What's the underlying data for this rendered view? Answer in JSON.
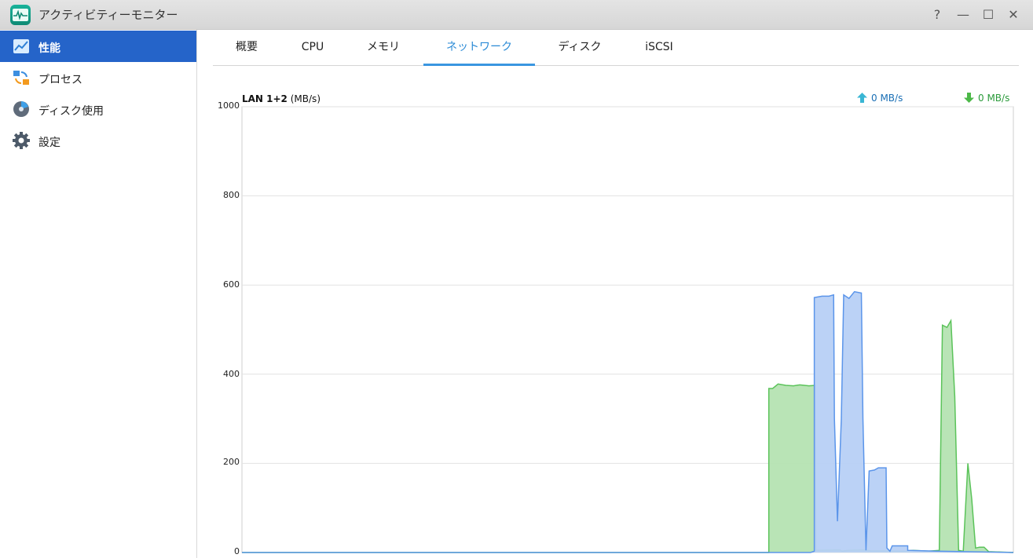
{
  "window": {
    "title": "アクティビティーモニター",
    "help": "?",
    "minimize": "—",
    "maximize": "☐",
    "close": "✕"
  },
  "sidebar": {
    "items": [
      {
        "label": "性能",
        "icon": "performance-chart-icon",
        "active": true
      },
      {
        "label": "プロセス",
        "icon": "process-icon",
        "active": false
      },
      {
        "label": "ディスク使用",
        "icon": "disk-usage-icon",
        "active": false
      },
      {
        "label": "設定",
        "icon": "gear-icon",
        "active": false
      }
    ]
  },
  "tabs": [
    {
      "label": "概要",
      "active": false
    },
    {
      "label": "CPU",
      "active": false
    },
    {
      "label": "メモリ",
      "active": false
    },
    {
      "label": "ネットワーク",
      "active": true
    },
    {
      "label": "ディスク",
      "active": false
    },
    {
      "label": "iSCSI",
      "active": false
    }
  ],
  "network": {
    "interface_bold": "LAN 1+2",
    "unit": "(MB/s)",
    "upload_rate": "0 MB/s",
    "download_rate": "0 MB/s"
  },
  "colors": {
    "accent": "#2564c9",
    "tab_active": "#2a8ad6",
    "upload_fill": "#b7d0f5",
    "upload_line": "#5b95ea",
    "download_fill": "#b5e3b2",
    "download_line": "#5bc35a"
  },
  "chart_data": {
    "type": "area",
    "ylabel": "MB/s",
    "ylim": [
      0,
      1000
    ],
    "yticks": [
      1000,
      800,
      600,
      400,
      200,
      0
    ],
    "grid": true,
    "x_range": [
      0,
      100
    ],
    "series": [
      {
        "role": "download",
        "points": [
          [
            0,
            0
          ],
          [
            68.3,
            0
          ],
          [
            68.3,
            368
          ],
          [
            68.8,
            368
          ],
          [
            69.5,
            378
          ],
          [
            70.5,
            375
          ],
          [
            71.5,
            374
          ],
          [
            72.3,
            376
          ],
          [
            73.5,
            374
          ],
          [
            74.3,
            375
          ],
          [
            74.4,
            5
          ],
          [
            77.5,
            6
          ],
          [
            77.8,
            3
          ],
          [
            78.5,
            5
          ],
          [
            80.5,
            6
          ],
          [
            81.5,
            4
          ],
          [
            86,
            3
          ],
          [
            87,
            5
          ],
          [
            89,
            3
          ],
          [
            90.4,
            5
          ],
          [
            90.8,
            510
          ],
          [
            91.4,
            505
          ],
          [
            91.9,
            520
          ],
          [
            92.4,
            350
          ],
          [
            92.9,
            5
          ],
          [
            93.5,
            3
          ],
          [
            94.1,
            200
          ],
          [
            94.6,
            120
          ],
          [
            95.1,
            10
          ],
          [
            95.6,
            12
          ],
          [
            96.2,
            12
          ],
          [
            96.8,
            2
          ],
          [
            100,
            0
          ]
        ]
      },
      {
        "role": "upload",
        "points": [
          [
            0,
            0
          ],
          [
            72.5,
            0
          ],
          [
            73.7,
            0
          ],
          [
            74.2,
            3
          ],
          [
            74.2,
            572
          ],
          [
            75.2,
            575
          ],
          [
            76.1,
            575
          ],
          [
            76.7,
            578
          ],
          [
            76.8,
            300
          ],
          [
            77.2,
            70
          ],
          [
            77.7,
            300
          ],
          [
            78,
            578
          ],
          [
            78.7,
            570
          ],
          [
            79.4,
            585
          ],
          [
            80.3,
            582
          ],
          [
            80.5,
            300
          ],
          [
            80.9,
            5
          ],
          [
            81.3,
            183
          ],
          [
            82,
            185
          ],
          [
            82.5,
            190
          ],
          [
            83.5,
            190
          ],
          [
            83.6,
            10
          ],
          [
            84,
            3
          ],
          [
            84.3,
            15
          ],
          [
            86.3,
            15
          ],
          [
            86.3,
            5
          ],
          [
            90,
            3
          ],
          [
            100,
            0
          ]
        ]
      }
    ]
  }
}
